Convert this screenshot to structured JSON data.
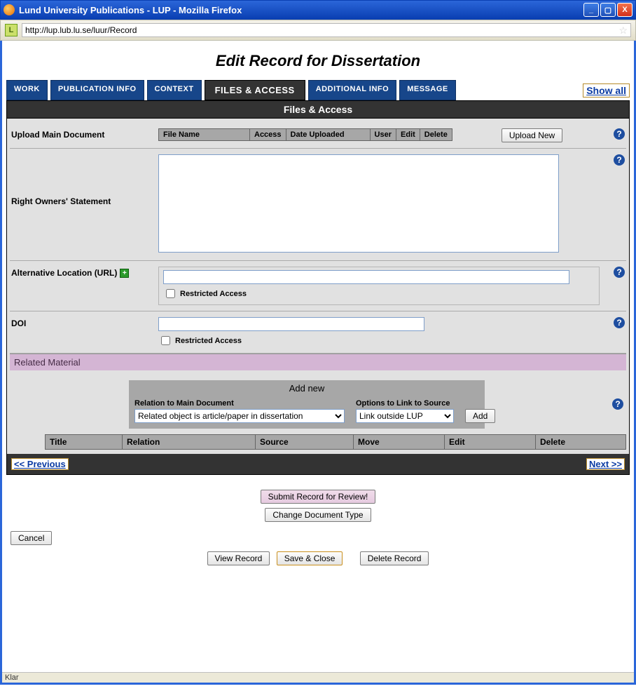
{
  "window": {
    "title": "Lund University Publications - LUP - Mozilla Firefox",
    "url": "http://lup.lub.lu.se/luur/Record",
    "status": "Klar"
  },
  "page": {
    "title": "Edit Record for Dissertation",
    "show_all": "Show all"
  },
  "tabs": {
    "work": "WORK",
    "pubinfo": "PUBLICATION INFO",
    "context": "CONTEXT",
    "files": "FILES & ACCESS",
    "addl": "ADDITIONAL INFO",
    "message": "MESSAGE"
  },
  "panel": {
    "heading": "Files & Access",
    "upload_label": "Upload Main Document",
    "upload_columns": {
      "filename": "File Name",
      "access": "Access",
      "date": "Date Uploaded",
      "user": "User",
      "edit": "Edit",
      "delete": "Delete"
    },
    "upload_new": "Upload New",
    "rights_label": "Right Owners' Statement",
    "rights_value": "",
    "alt_label": "Alternative Location (URL)",
    "alt_value": "",
    "restricted_label": "Restricted Access",
    "doi_label": "DOI",
    "doi_value": ""
  },
  "related": {
    "heading": "Related Material",
    "add_new": "Add new",
    "relation_label": "Relation to Main Document",
    "relation_selected": "Related object is article/paper in dissertation",
    "options_label": "Options to Link to Source",
    "options_selected": "Link outside LUP",
    "add_button": "Add",
    "columns": {
      "title": "Title",
      "relation": "Relation",
      "source": "Source",
      "move": "Move",
      "edit": "Edit",
      "delete": "Delete"
    }
  },
  "nav": {
    "prev": "<< Previous",
    "next": "Next >>"
  },
  "actions": {
    "submit": "Submit Record for Review!",
    "change_type": "Change Document Type",
    "cancel": "Cancel",
    "view": "View Record",
    "save": "Save & Close",
    "delete": "Delete Record"
  }
}
